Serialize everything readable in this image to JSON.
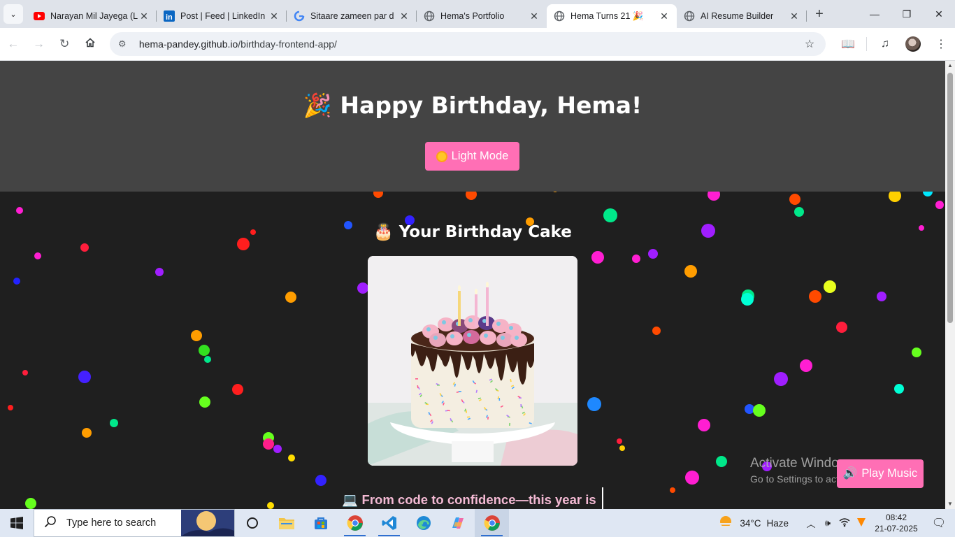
{
  "browser": {
    "tabs": [
      {
        "title": "Narayan Mil Jayega (L",
        "favicon": "youtube-icon",
        "active": false
      },
      {
        "title": "Post | Feed | LinkedIn",
        "favicon": "linkedin-icon",
        "active": false
      },
      {
        "title": "Sitaare zameen par d",
        "favicon": "google-icon",
        "active": false
      },
      {
        "title": "Hema's Portfolio",
        "favicon": "globe-icon",
        "active": false
      },
      {
        "title": "Hema Turns 21 🎉",
        "favicon": "globe-icon",
        "active": true
      },
      {
        "title": "AI Resume Builder",
        "favicon": "globe-icon",
        "active": false
      }
    ],
    "url_host": "hema-pandey.github.io",
    "url_path": "/birthday-frontend-app/"
  },
  "page": {
    "heading": "🎉 Happy Birthday, Hema!",
    "mode_button": "Light Mode",
    "cake_heading": "🎂 Your Birthday Cake",
    "typing_text": "💻 From code to confidence—this year is",
    "music_button": "Play Music",
    "colors": {
      "header_bg": "#444444",
      "page_bg": "#1f1f1f",
      "accent_pink": "#ff6fb5",
      "typing_pink": "#f3b9d3"
    }
  },
  "watermark": {
    "line1": "Activate Windows",
    "line2": "Go to Settings to activate Windows."
  },
  "taskbar": {
    "search_placeholder": "Type here to search",
    "weather_temp": "34°C",
    "weather_desc": "Haze",
    "time": "08:42",
    "date": "21-07-2025"
  }
}
